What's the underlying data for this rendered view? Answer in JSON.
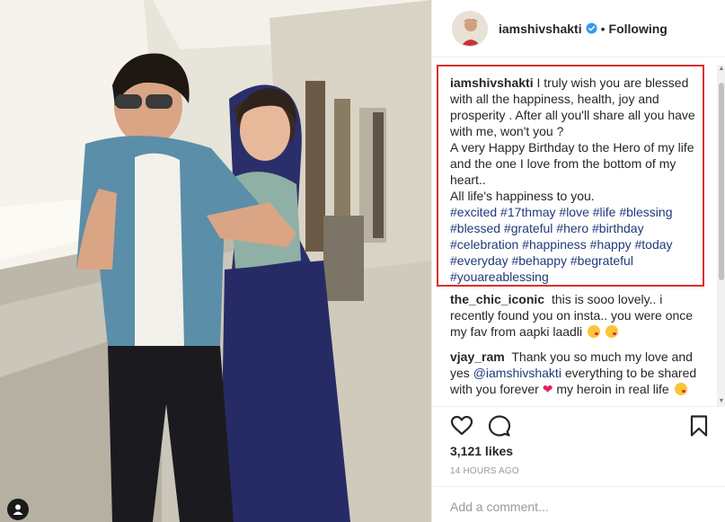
{
  "header": {
    "username": "iamshivshakti",
    "separator": "•",
    "follow_status": "Following"
  },
  "caption": {
    "username": "iamshivshakti",
    "line1": "I truly wish you are blessed with all the happiness, health, joy and prosperity . After all you'll share all you have with me, won't you ?",
    "line2": "A very Happy Birthday to the Hero of my life and the one I love from the bottom of my heart..",
    "line3": "All life's happiness to you.",
    "hashtags": "#excited #17thmay #love #life #blessing #blessed #grateful #hero #birthday #celebration #happiness #happy #today #everyday #behappy #begrateful #youareablessing"
  },
  "comments": [
    {
      "username": "the_chic_iconic",
      "text": "this is sooo lovely.. i recently found you on insta.. you were once my fav from aapki laadli"
    },
    {
      "username": "vjay_ram",
      "text_a": "Thank you so much my love and yes",
      "mention": "@iamshivshakti",
      "text_b": "everything to be shared with you forever",
      "text_c": "my heroin in real life"
    }
  ],
  "stats": {
    "likes": "3,121 likes",
    "time": "14 HOURS AGO"
  },
  "add_comment": {
    "placeholder": "Add a comment..."
  },
  "icons": {
    "verified": "verified-badge-icon",
    "like": "heart-icon",
    "comment": "comment-bubble-icon",
    "save": "bookmark-icon",
    "badge": "user-tag-icon"
  },
  "colors": {
    "highlight_border": "#d9312b",
    "hashtag": "#1f3b7a",
    "verified": "#3897f0"
  }
}
